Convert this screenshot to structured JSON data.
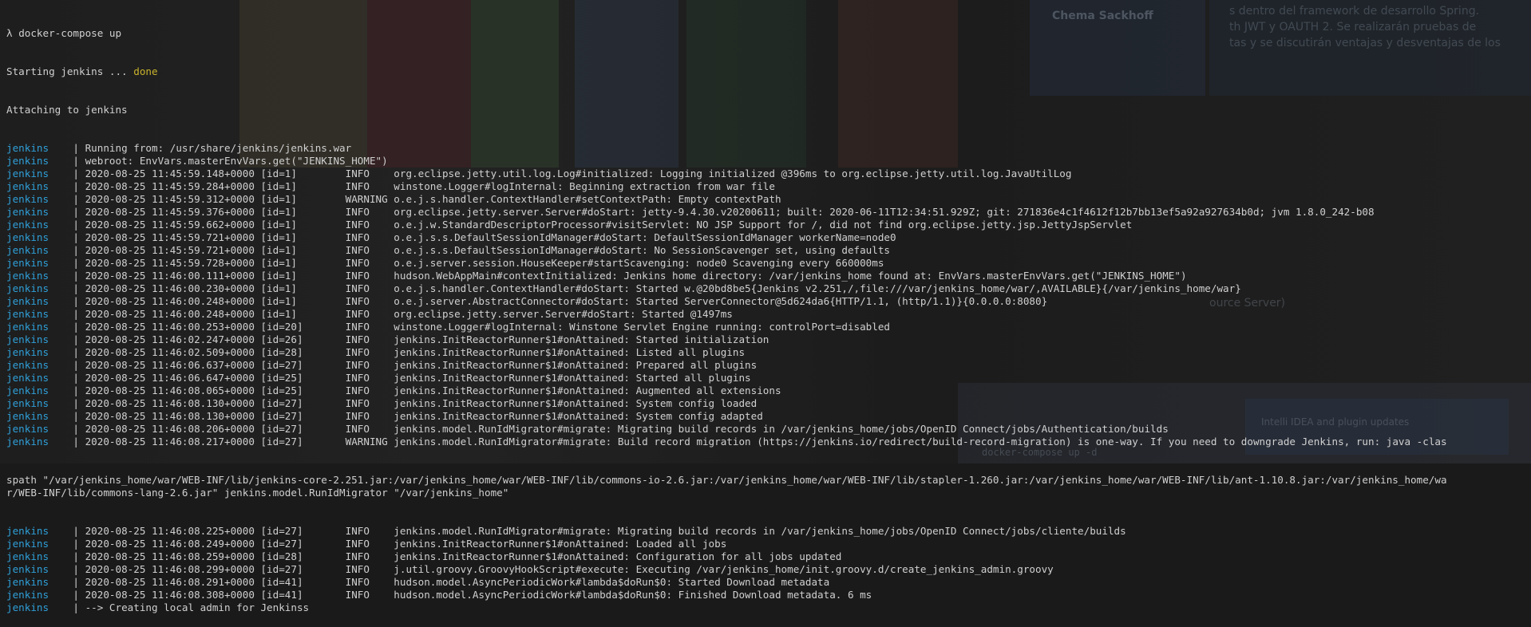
{
  "terminal": {
    "prompt_symbol": "λ",
    "command": "docker-compose up",
    "starting_prefix": "Starting jenkins ... ",
    "starting_status": "done",
    "attaching": "Attaching to jenkins",
    "service": "jenkins",
    "separator": "|",
    "log_lines": [
      {
        "text": " Running from: /usr/share/jenkins/jenkins.war"
      },
      {
        "text": " webroot: EnvVars.masterEnvVars.get(\"JENKINS_HOME\")"
      },
      {
        "text": " 2020-08-25 11:45:59.148+0000 [id=1]        INFO    org.eclipse.jetty.util.log.Log#initialized: Logging initialized @396ms to org.eclipse.jetty.util.log.JavaUtilLog"
      },
      {
        "text": " 2020-08-25 11:45:59.284+0000 [id=1]        INFO    winstone.Logger#logInternal: Beginning extraction from war file"
      },
      {
        "text": " 2020-08-25 11:45:59.312+0000 [id=1]        WARNING o.e.j.s.handler.ContextHandler#setContextPath: Empty contextPath"
      },
      {
        "text": " 2020-08-25 11:45:59.376+0000 [id=1]        INFO    org.eclipse.jetty.server.Server#doStart: jetty-9.4.30.v20200611; built: 2020-06-11T12:34:51.929Z; git: 271836e4c1f4612f12b7bb13ef5a92a927634b0d; jvm 1.8.0_242-b08"
      },
      {
        "text": " 2020-08-25 11:45:59.662+0000 [id=1]        INFO    o.e.j.w.StandardDescriptorProcessor#visitServlet: NO JSP Support for /, did not find org.eclipse.jetty.jsp.JettyJspServlet"
      },
      {
        "text": " 2020-08-25 11:45:59.721+0000 [id=1]        INFO    o.e.j.s.s.DefaultSessionIdManager#doStart: DefaultSessionIdManager workerName=node0"
      },
      {
        "text": " 2020-08-25 11:45:59.721+0000 [id=1]        INFO    o.e.j.s.s.DefaultSessionIdManager#doStart: No SessionScavenger set, using defaults"
      },
      {
        "text": " 2020-08-25 11:45:59.728+0000 [id=1]        INFO    o.e.j.server.session.HouseKeeper#startScavenging: node0 Scavenging every 660000ms"
      },
      {
        "text": " 2020-08-25 11:46:00.111+0000 [id=1]        INFO    hudson.WebAppMain#contextInitialized: Jenkins home directory: /var/jenkins_home found at: EnvVars.masterEnvVars.get(\"JENKINS_HOME\")"
      },
      {
        "text": " 2020-08-25 11:46:00.230+0000 [id=1]        INFO    o.e.j.s.handler.ContextHandler#doStart: Started w.@20bd8be5{Jenkins v2.251,/,file:///var/jenkins_home/war/,AVAILABLE}{/var/jenkins_home/war}"
      },
      {
        "text": " 2020-08-25 11:46:00.248+0000 [id=1]        INFO    o.e.j.server.AbstractConnector#doStart: Started ServerConnector@5d624da6{HTTP/1.1, (http/1.1)}{0.0.0.0:8080}"
      },
      {
        "text": " 2020-08-25 11:46:00.248+0000 [id=1]        INFO    org.eclipse.jetty.server.Server#doStart: Started @1497ms"
      },
      {
        "text": " 2020-08-25 11:46:00.253+0000 [id=20]       INFO    winstone.Logger#logInternal: Winstone Servlet Engine running: controlPort=disabled"
      },
      {
        "text": " 2020-08-25 11:46:02.247+0000 [id=26]       INFO    jenkins.InitReactorRunner$1#onAttained: Started initialization"
      },
      {
        "text": " 2020-08-25 11:46:02.509+0000 [id=28]       INFO    jenkins.InitReactorRunner$1#onAttained: Listed all plugins"
      },
      {
        "text": " 2020-08-25 11:46:06.637+0000 [id=27]       INFO    jenkins.InitReactorRunner$1#onAttained: Prepared all plugins"
      },
      {
        "text": " 2020-08-25 11:46:06.647+0000 [id=25]       INFO    jenkins.InitReactorRunner$1#onAttained: Started all plugins"
      },
      {
        "text": " 2020-08-25 11:46:08.065+0000 [id=25]       INFO    jenkins.InitReactorRunner$1#onAttained: Augmented all extensions"
      },
      {
        "text": " 2020-08-25 11:46:08.130+0000 [id=27]       INFO    jenkins.InitReactorRunner$1#onAttained: System config loaded"
      },
      {
        "text": " 2020-08-25 11:46:08.130+0000 [id=27]       INFO    jenkins.InitReactorRunner$1#onAttained: System config adapted"
      },
      {
        "text": " 2020-08-25 11:46:08.206+0000 [id=27]       INFO    jenkins.model.RunIdMigrator#migrate: Migrating build records in /var/jenkins_home/jobs/OpenID Connect/jobs/Authentication/builds"
      },
      {
        "text": " 2020-08-25 11:46:08.217+0000 [id=27]       WARNING jenkins.model.RunIdMigrator#migrate: Build record migration (https://jenkins.io/redirect/build-record-migration) is one-way. If you need to downgrade Jenkins, run: java -clas"
      }
    ],
    "wrapped_lines": [
      "spath \"/var/jenkins_home/war/WEB-INF/lib/jenkins-core-2.251.jar:/var/jenkins_home/war/WEB-INF/lib/commons-io-2.6.jar:/var/jenkins_home/war/WEB-INF/lib/stapler-1.260.jar:/var/jenkins_home/war/WEB-INF/lib/ant-1.10.8.jar:/var/jenkins_home/wa",
      "r/WEB-INF/lib/commons-lang-2.6.jar\" jenkins.model.RunIdMigrator \"/var/jenkins_home\""
    ],
    "log_lines_2": [
      {
        "text": " 2020-08-25 11:46:08.225+0000 [id=27]       INFO    jenkins.model.RunIdMigrator#migrate: Migrating build records in /var/jenkins_home/jobs/OpenID Connect/jobs/cliente/builds"
      },
      {
        "text": " 2020-08-25 11:46:08.249+0000 [id=27]       INFO    jenkins.InitReactorRunner$1#onAttained: Loaded all jobs"
      },
      {
        "text": " 2020-08-25 11:46:08.259+0000 [id=28]       INFO    jenkins.InitReactorRunner$1#onAttained: Configuration for all jobs updated"
      },
      {
        "text": " 2020-08-25 11:46:08.299+0000 [id=27]       INFO    j.util.groovy.GroovyHookScript#execute: Executing /var/jenkins_home/init.groovy.d/create_jenkins_admin.groovy"
      },
      {
        "text": " 2020-08-25 11:46:08.291+0000 [id=41]       INFO    hudson.model.AsyncPeriodicWork#lambda$doRun$0: Started Download metadata"
      },
      {
        "text": " 2020-08-25 11:46:08.308+0000 [id=41]       INFO    hudson.model.AsyncPeriodicWork#lambda$doRun$0: Finished Download metadata. 6 ms"
      },
      {
        "text": " --> Creating local admin for Jenkinss"
      }
    ]
  },
  "background": {
    "profile_name": "Chema Sackhoff",
    "text_1": "s dentro del framework de desarrollo Spring.",
    "text_2": "th JWT y OAUTH 2. Se realizarán pruebas de",
    "text_3": "tas y se discutirán ventajas y desventajas de los",
    "text_4": "ource Server)",
    "text_5": "Intelli IDEA and plugin updates",
    "text_6": "docker-compose up -d"
  }
}
